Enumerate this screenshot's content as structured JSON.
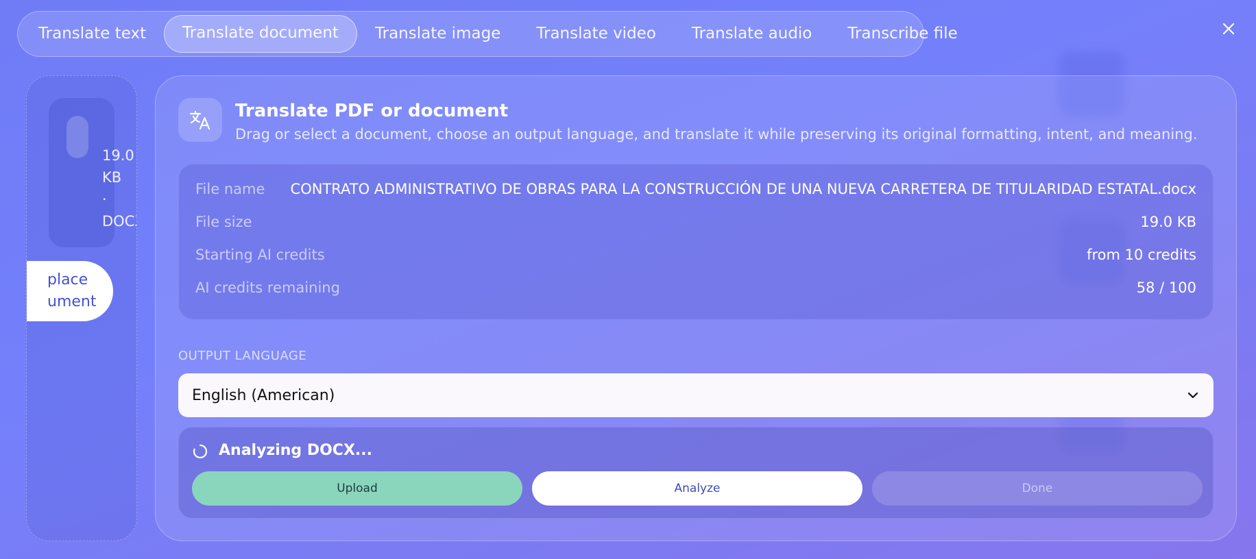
{
  "tabs": [
    {
      "label": "Translate text"
    },
    {
      "label": "Translate document",
      "active": true
    },
    {
      "label": "Translate image"
    },
    {
      "label": "Translate video"
    },
    {
      "label": "Translate audio"
    },
    {
      "label": "Transcribe file"
    }
  ],
  "close_icon": "close-icon",
  "sidebar": {
    "file_size_lines": [
      "19.0",
      "KB",
      "·",
      "DOCX"
    ],
    "replace_lines": [
      "place",
      "ument"
    ]
  },
  "header": {
    "icon": "translate-icon",
    "title": "Translate PDF or document",
    "subtitle": "Drag or select a document, choose an output language, and translate it while preserving its original formatting, intent, and meaning."
  },
  "info": {
    "file_name_label": "File name",
    "file_name": "CONTRATO ADMINISTRATIVO DE OBRAS PARA LA CONSTRUCCIÓN DE UNA NUEVA CARRETERA DE TITULARIDAD ESTATAL.docx",
    "file_size_label": "File size",
    "file_size": "19.0 KB",
    "starting_credits_label": "Starting AI credits",
    "starting_credits": "from 10 credits",
    "remaining_label": "AI credits remaining",
    "remaining": "58 / 100"
  },
  "output": {
    "label": "OUTPUT LANGUAGE",
    "selected": "English (American)"
  },
  "status": {
    "text": "Analyzing DOCX...",
    "steps": {
      "upload": "Upload",
      "analyze": "Analyze",
      "done": "Done"
    }
  },
  "colors": {
    "upload": "#8ad6bd",
    "accent_text": "#3d4bb8"
  }
}
